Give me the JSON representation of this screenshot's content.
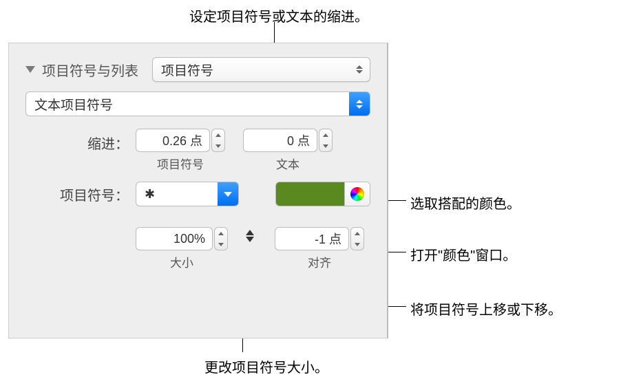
{
  "annotations": {
    "top": "设定项目符号或文本的缩进。",
    "color_pick": "选取搭配的颜色。",
    "color_window": "打开\"颜色\"窗口。",
    "align": "将项目符号上移或下移。",
    "size": "更改项目符号大小。"
  },
  "panel": {
    "header": {
      "title": "项目符号与列表",
      "list_type": "项目符号"
    },
    "bullet_style": "文本项目符号",
    "indent": {
      "label": "缩进：",
      "bullet_value": "0.26 点",
      "bullet_sublabel": "项目符号",
      "text_value": "0 点",
      "text_sublabel": "文本"
    },
    "bullet": {
      "label": "项目符号：",
      "glyph": "✱"
    },
    "colors": {
      "swatch_hex": "#5a8a1f"
    },
    "size": {
      "value": "100%",
      "sublabel": "大小"
    },
    "align": {
      "value": "-1 点",
      "sublabel": "对齐"
    }
  }
}
